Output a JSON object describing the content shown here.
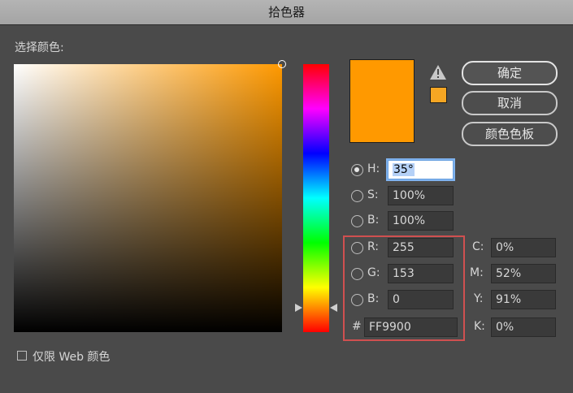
{
  "window": {
    "title": "拾色器"
  },
  "picker": {
    "select_color_label": "选择颜色:"
  },
  "buttons": {
    "ok": "确定",
    "cancel": "取消",
    "swatches": "颜色色板"
  },
  "colors": {
    "current": "#FF9900",
    "web_safe": "#F5A623",
    "highlight": "#D05050"
  },
  "hsb": {
    "h": {
      "label": "H:",
      "value": "35",
      "suffix": "°"
    },
    "s": {
      "label": "S:",
      "value": "100%"
    },
    "b": {
      "label": "B:",
      "value": "100%"
    }
  },
  "rgb": {
    "r": {
      "label": "R:",
      "value": "255"
    },
    "g": {
      "label": "G:",
      "value": "153"
    },
    "b": {
      "label": "B:",
      "value": "0"
    }
  },
  "hex": {
    "label": "#",
    "value": "FF9900"
  },
  "cmyk": {
    "c": {
      "label": "C:",
      "value": "0%"
    },
    "m": {
      "label": "M:",
      "value": "52%"
    },
    "y": {
      "label": "Y:",
      "value": "91%"
    },
    "k": {
      "label": "K:",
      "value": "0%"
    }
  },
  "web_only": {
    "label": "仅限 Web 颜色",
    "checked": false
  },
  "icons": {
    "warning": "warning-triangle-icon"
  }
}
